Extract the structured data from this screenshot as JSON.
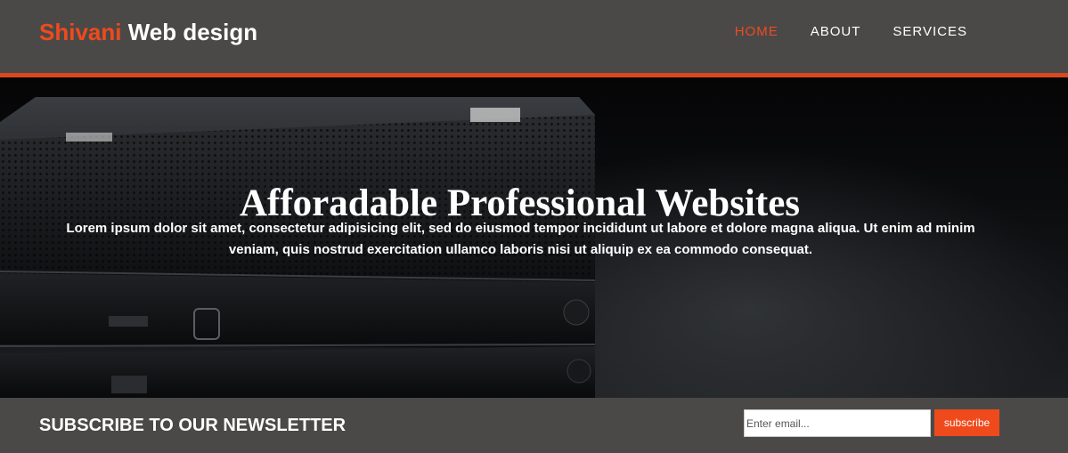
{
  "header": {
    "logo_highlight": "Shivani",
    "logo_rest": " Web design",
    "nav": [
      {
        "label": "HOME",
        "active": true
      },
      {
        "label": "ABOUT",
        "active": false
      },
      {
        "label": "SERVICES",
        "active": false
      }
    ]
  },
  "hero": {
    "title": "Afforadable Professional Websites",
    "text": "Lorem ipsum dolor sit amet, consectetur adipisicing elit, sed do eiusmod tempor incididunt ut labore et dolore magna aliqua. Ut enim ad minim veniam, quis nostrud exercitation ullamco laboris nisi ut aliquip ex ea commodo consequat."
  },
  "newsletter": {
    "title": "SUBSCRIBE TO OUR NEWSLETTER",
    "email_placeholder": "Enter email...",
    "subscribe_label": "subscribe"
  },
  "colors": {
    "accent": "#ef4a1c",
    "bar_bg": "#4a4948",
    "header_border": "#d9481f"
  }
}
